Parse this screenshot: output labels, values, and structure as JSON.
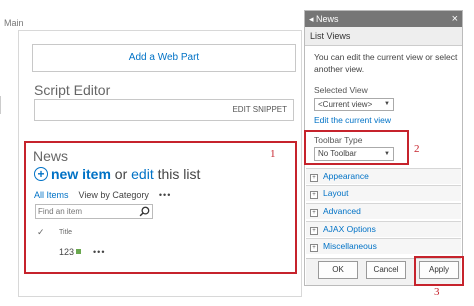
{
  "page": {
    "main_label": "Main",
    "add_web_part": "Add a Web Part",
    "script_editor": {
      "title": "Script Editor",
      "edit_snippet": "EDIT SNIPPET"
    },
    "news_part": {
      "title": "News",
      "new_item": "new item",
      "or_text": "or",
      "edit_link": "edit",
      "this_list": "this list",
      "views": [
        "All Items",
        "View by Category"
      ],
      "more": "•••",
      "find_placeholder": "Find an item",
      "column_title": "Title",
      "row_value": "123",
      "row_more": "•••"
    }
  },
  "annotations": {
    "one": "1",
    "two": "2",
    "three": "3"
  },
  "tool_pane": {
    "header": "News",
    "close": "×",
    "section": "List Views",
    "description": "You can edit the current view or select another view.",
    "selected_view_label": "Selected View",
    "selected_view_value": "<Current view>",
    "edit_current_view": "Edit the current view",
    "toolbar_type_label": "Toolbar Type",
    "toolbar_type_value": "No Toolbar",
    "categories": [
      "Appearance",
      "Layout",
      "Advanced",
      "AJAX Options",
      "Miscellaneous"
    ],
    "buttons": {
      "ok": "OK",
      "cancel": "Cancel",
      "apply": "Apply"
    }
  },
  "colors": {
    "accent": "#0072c6",
    "annotation_red": "#c6232c",
    "pane_header": "#767676"
  }
}
